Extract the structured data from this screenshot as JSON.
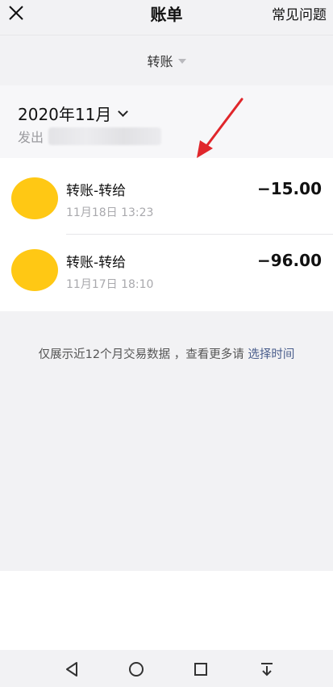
{
  "header": {
    "title": "账单",
    "faq_label": "常见问题"
  },
  "filter": {
    "label": "转账"
  },
  "month_section": {
    "month": "2020年11月",
    "out_label": "发出"
  },
  "transactions": [
    {
      "title": "转账-转给",
      "time": "11月18日 13:23",
      "amount": "−15.00"
    },
    {
      "title": "转账-转给",
      "time": "11月17日 18:10",
      "amount": "−96.00"
    }
  ],
  "footer_note": {
    "text": "仅展示近12个月交易数据 ，查看更多请 ",
    "link": "选择时间"
  },
  "colors": {
    "avatar": "#ffc814",
    "annotation_arrow": "#e0262b",
    "link": "#4a5e8c"
  }
}
